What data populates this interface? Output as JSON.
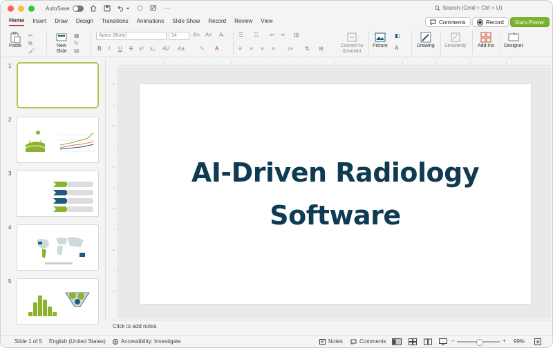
{
  "titlebar": {
    "autosave_label": "AutoSave",
    "search_placeholder": "Search (Cmd + Ctrl + U)"
  },
  "tabs": [
    {
      "label": "Home",
      "active": true
    },
    {
      "label": "Insert"
    },
    {
      "label": "Draw"
    },
    {
      "label": "Design"
    },
    {
      "label": "Transitions"
    },
    {
      "label": "Animations"
    },
    {
      "label": "Slide Show"
    },
    {
      "label": "Record"
    },
    {
      "label": "Review"
    },
    {
      "label": "View"
    }
  ],
  "top_buttons": {
    "comments": "Comments",
    "record": "Record",
    "guru": "Guru Power"
  },
  "ribbon": {
    "paste": "Paste",
    "new_slide": "New\nSlide",
    "font_name": "Aptos (Body)",
    "font_size": "24",
    "convert_smartart": "Convert to SmartArt",
    "picture": "Picture",
    "drawing": "Drawing",
    "sensitivity": "Sensitivity",
    "addins": "Add-ins",
    "designer": "Designer"
  },
  "slides": [
    {
      "number": "1"
    },
    {
      "number": "2"
    },
    {
      "number": "3"
    },
    {
      "number": "4"
    },
    {
      "number": "5"
    }
  ],
  "slide": {
    "title_line1": "AI-Driven Radiology",
    "title_line2": "Software"
  },
  "notes_placeholder": "Click to add notes",
  "status": {
    "slide_count": "Slide 1 of 5",
    "language": "English (United States)",
    "accessibility": "Accessibility: Investigate",
    "notes": "Notes",
    "comments": "Comments",
    "zoom": "99%"
  },
  "colors": {
    "accent": "#b7472a",
    "title": "#0e3a52",
    "green": "#8db32e",
    "navy": "#1f5b7a"
  }
}
